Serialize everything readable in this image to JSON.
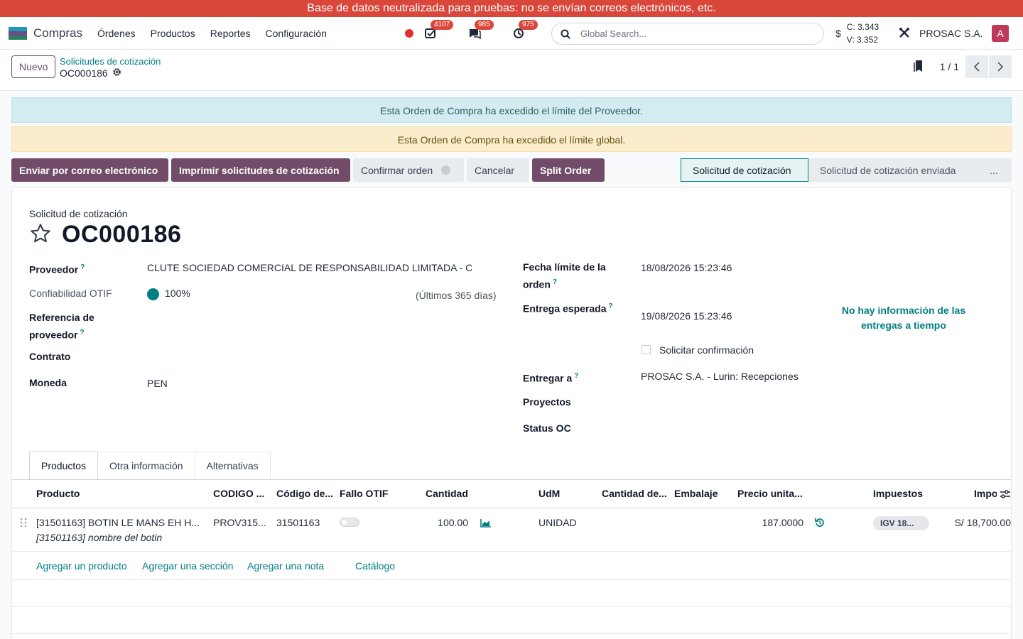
{
  "banner": "Base de datos neutralizada para pruebas: no se envían correos electrónicos, etc.",
  "nav": {
    "app_name": "Compras",
    "menu": [
      "Órdenes",
      "Productos",
      "Reportes",
      "Configuración"
    ],
    "badges": {
      "activities": "4107",
      "messages": "985",
      "timers": "975"
    },
    "search_placeholder": "Global Search...",
    "rate_symbol": "$",
    "rate_c": "C: 3.343",
    "rate_v": "V: 3.352",
    "company": "PROSAC S.A.",
    "avatar_letter": "A",
    "colors": {
      "brand": "#714b67",
      "accent": "#017e84",
      "banner": "#d9473b",
      "avatar": "#c0395a"
    }
  },
  "control": {
    "new_label": "Nuevo",
    "breadcrumb_parent": "Solicitudes de cotización",
    "breadcrumb_current": "OC000186",
    "pager": "1 / 1"
  },
  "alerts": {
    "info": "Esta Orden de Compra ha excedido el límite del Proveedor.",
    "warning": "Esta Orden de Compra ha excedido el límite global."
  },
  "statusbar": {
    "buttons": [
      "Enviar por correo electrónico",
      "Imprimir solicitudes de cotización",
      "Confirmar orden",
      "Cancelar",
      "Split Order"
    ],
    "stages": [
      "Solicitud de cotización",
      "Solicitud de cotización enviada",
      "..."
    ]
  },
  "form": {
    "doc_type": "Solicitud de cotización",
    "name": "OC000186",
    "proveedor_label": "Proveedor",
    "proveedor_value": "CLUTE SOCIEDAD COMERCIAL DE RESPONSABILIDAD LIMITADA - CLUTE S.R.L.",
    "otif_label": "Confiabilidad OTIF",
    "otif_value": "100%",
    "otif_period": "(Últimos 365 días)",
    "ref_label_1": "Referencia de",
    "ref_label_2": "proveedor",
    "contrato_label": "Contrato",
    "moneda_label": "Moneda",
    "moneda_value": "PEN",
    "fecha_limite_label_1": "Fecha límite de la",
    "fecha_limite_label_2": "orden",
    "fecha_limite_value": "18/08/2026 15:23:46",
    "entrega_label": "Entrega esperada",
    "entrega_value": "19/08/2026 15:23:46",
    "ontime_text": "No hay información de las entregas a tiempo",
    "solicitar_label": "Solicitar confirmación",
    "entregar_label": "Entregar a",
    "entregar_value": "PROSAC S.A. - Lurin: Recepciones",
    "proyectos_label": "Proyectos",
    "status_label": "Status OC",
    "tooltip_mark": "?"
  },
  "tabs": [
    "Productos",
    "Otra información",
    "Alternativas"
  ],
  "table": {
    "headers": [
      "Producto",
      "CODIGO ...",
      "Código de...",
      "Fallo OTIF",
      "Cantidad",
      "UdM",
      "Cantidad de...",
      "Embalaje",
      "Precio unita...",
      "Impuestos",
      "Impo"
    ],
    "row": {
      "producto": "[31501163] BOTIN LE MANS EH H...",
      "codigo": "PROV315...",
      "codigo_de": "31501163",
      "cantidad": "100.00",
      "udm": "UNIDAD",
      "precio": "187.0000",
      "impuesto": "IGV 18...",
      "importe": "S/ 18,700.00",
      "note": "[31501163] nombre del botin"
    },
    "add_links": [
      "Agregar un producto",
      "Agregar una sección",
      "Agregar una nota",
      "Catálogo"
    ]
  }
}
